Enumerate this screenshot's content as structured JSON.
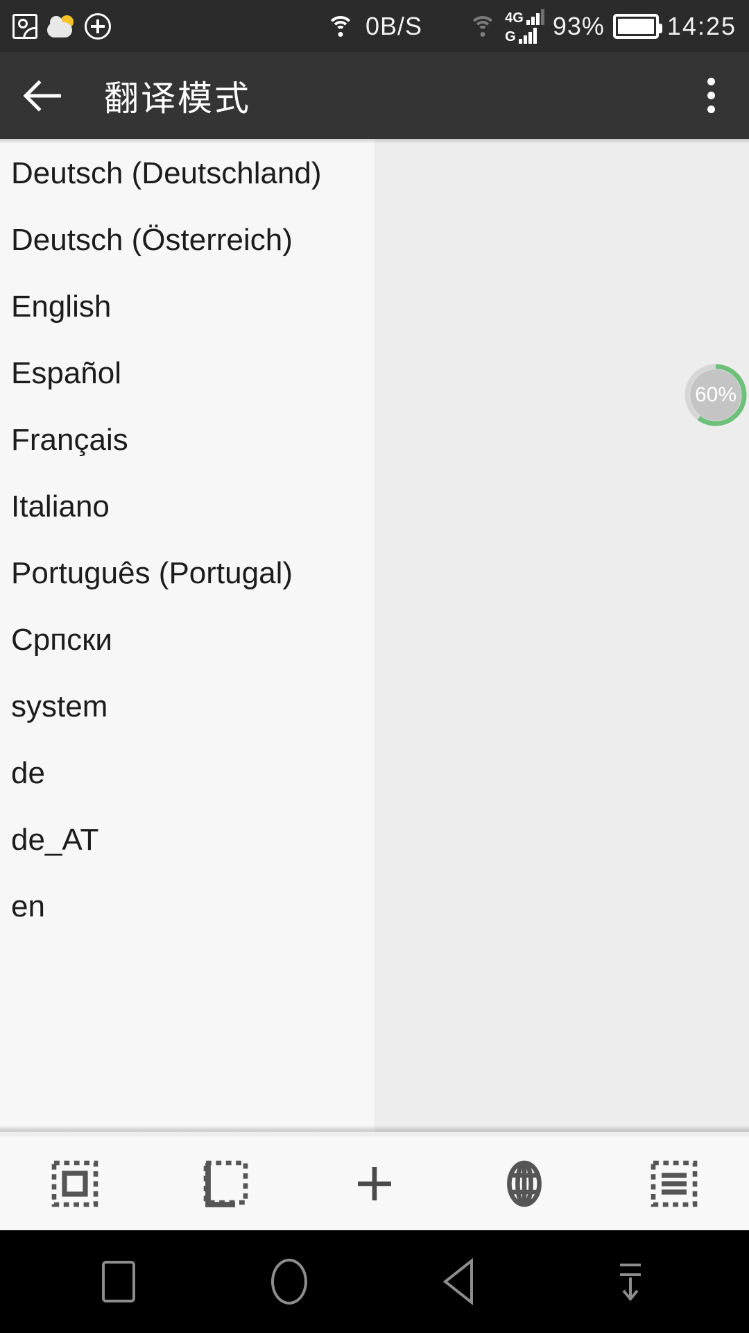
{
  "statusbar": {
    "left_icons": [
      "image-icon",
      "weather-cloud-sun-icon",
      "plus-circle-icon"
    ],
    "network_speed": "0B/S",
    "wifi_icon": "wifi-icon",
    "sim1_label": "4G",
    "sim2_label": "G",
    "battery_percent": "93%",
    "battery_icon": "battery-full-icon",
    "time": "14:25"
  },
  "appbar": {
    "back_icon": "back-arrow-icon",
    "title": "翻译模式",
    "overflow_icon": "overflow-menu-icon"
  },
  "progress": {
    "label": "60%",
    "value": 60,
    "track_color": "#c4c4c4",
    "arc_color": "#6cc07a",
    "text_color": "#ffffff"
  },
  "list": {
    "items": [
      {
        "label": "Deutsch (Deutschland)"
      },
      {
        "label": "Deutsch (Österreich)"
      },
      {
        "label": "English"
      },
      {
        "label": "Español"
      },
      {
        "label": "Français"
      },
      {
        "label": "Italiano"
      },
      {
        "label": "Português (Portugal)"
      },
      {
        "label": "Српски"
      },
      {
        "label": "system"
      },
      {
        "label": "de"
      },
      {
        "label": "de_AT"
      },
      {
        "label": "en"
      }
    ]
  },
  "toolbar": {
    "buttons": [
      {
        "icon": "select-frame-icon"
      },
      {
        "icon": "crop-corner-icon"
      },
      {
        "icon": "plus-icon"
      },
      {
        "icon": "globe-icon"
      },
      {
        "icon": "list-frame-icon"
      }
    ]
  },
  "navbar": {
    "buttons": [
      {
        "icon": "recents-square-icon"
      },
      {
        "icon": "home-circle-icon"
      },
      {
        "icon": "back-triangle-icon"
      },
      {
        "icon": "hide-navbar-icon"
      }
    ]
  },
  "colors": {
    "statusbar_bg": "#2b2b2b",
    "appbar_bg": "#343434",
    "list_bg": "#f7f7f7",
    "content_bg": "#ededed",
    "toolbar_bg": "#f8f8f8",
    "navbar_bg": "#000000",
    "accent_green": "#6cc07a"
  }
}
